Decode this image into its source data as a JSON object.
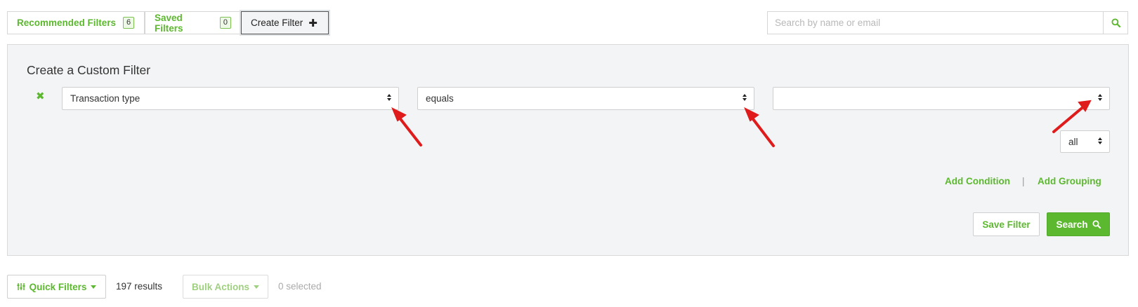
{
  "tabs": [
    {
      "label": "Recommended Filters",
      "count": "6"
    },
    {
      "label": "Saved Filters",
      "count": "0"
    },
    {
      "label": "Create Filter",
      "icon": "plus-icon"
    }
  ],
  "search": {
    "placeholder": "Search by name or email",
    "icon": "search-icon"
  },
  "panel": {
    "title": "Create a Custom Filter",
    "condition": {
      "field": "Transaction type",
      "operator": "equals",
      "value": ""
    },
    "match": "all",
    "add_condition": "Add Condition",
    "separator": "|",
    "add_grouping": "Add Grouping",
    "save_filter": "Save Filter",
    "search": "Search"
  },
  "footer": {
    "quick_filters": "Quick Filters",
    "results_count": "197",
    "results_label": "results",
    "bulk_actions": "Bulk Actions",
    "selected": "0 selected"
  },
  "colors": {
    "accent": "#5cb82f",
    "annotation": "#e01b1b"
  }
}
